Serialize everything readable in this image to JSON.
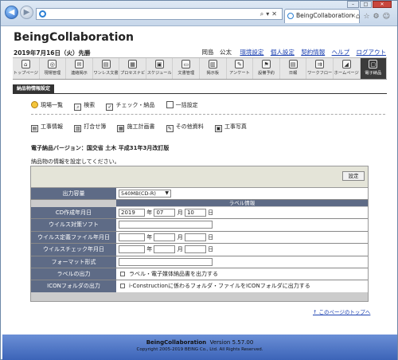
{
  "browser": {
    "tab_title": "BeingCollaboration",
    "address": ""
  },
  "header": {
    "brand": "BeingCollaboration",
    "date": "2019年7月16日（火）先勝",
    "user_name": "岡島　公太",
    "links": [
      "環境設定",
      "個人設定",
      "契約情報",
      "ヘルプ",
      "ログアウト"
    ]
  },
  "menu": [
    {
      "label": "トップページ",
      "icon": "home-icon"
    },
    {
      "label": "現場管理",
      "icon": "site-icon"
    },
    {
      "label": "連絡掲示",
      "icon": "mail-icon"
    },
    {
      "label": "ワンレス文書",
      "icon": "document-icon"
    },
    {
      "label": "プロセスナビ",
      "icon": "process-icon"
    },
    {
      "label": "スケジュール",
      "icon": "calendar-icon"
    },
    {
      "label": "文書管理",
      "icon": "folder-icon"
    },
    {
      "label": "掲示板",
      "icon": "board-icon"
    },
    {
      "label": "アンケート",
      "icon": "survey-icon"
    },
    {
      "label": "設備予約",
      "icon": "equipment-icon"
    },
    {
      "label": "日報",
      "icon": "report-icon"
    },
    {
      "label": "ワークフロー",
      "icon": "workflow-icon"
    },
    {
      "label": "ホームページ",
      "icon": "homepage-icon"
    },
    {
      "label": "電子納品",
      "icon": "delivery-icon"
    }
  ],
  "section_tag": "納品物情報設定",
  "toolbar1": [
    "現場一覧",
    "検索",
    "チェック・納品",
    "一括設定"
  ],
  "toolbar2": [
    "工事情報",
    "打合せ簿",
    "施工計画書",
    "その他資料",
    "工事写真"
  ],
  "version_text": "電子納品バージョン：国交省 土木 平成31年3月改訂版",
  "intro_text": "納品物の情報を設定してください。",
  "set_button": "設定",
  "form": {
    "capacity_label": "出力容量",
    "capacity_value": "540MB(CD-R)",
    "label_info_header": "ラベル情報",
    "cd_date_label": "CD作成年月日",
    "cd_year": "2019",
    "cd_month": "07",
    "cd_day": "10",
    "year_unit": "年",
    "month_unit": "月",
    "day_unit": "日",
    "virus_soft_label": "ウイルス対策ソフト",
    "virus_def_label": "ウイルス定義ファイル年月日",
    "virus_check_label": "ウイルスチェック年月日",
    "format_label": "フォーマット形式",
    "label_output_label": "ラベルの出力",
    "label_output_text": "ラベル・電子媒体納品書を出力する",
    "icon_folder_label": "ICONフォルダの出力",
    "icon_folder_text": "i-Constructionに係わるフォルダ・ファイルをICONフォルダに出力する"
  },
  "to_top": "このページのトップへ",
  "footer": {
    "brand": "BeingCollaboration",
    "version": "Version 5.57.00",
    "copyright": "Copyright 2005-2019 BEING Co., Ltd. All Rights Reserved."
  }
}
